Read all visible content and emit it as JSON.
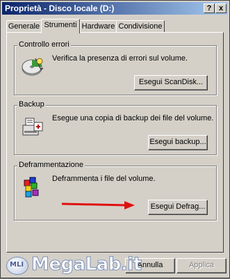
{
  "window": {
    "title": "Proprietà - Disco locale (D:)",
    "help_label": "?",
    "close_label": "x"
  },
  "tabs": [
    {
      "label": "Generale"
    },
    {
      "label": "Strumenti"
    },
    {
      "label": "Hardware"
    },
    {
      "label": "Condivisione"
    }
  ],
  "groups": {
    "error_check": {
      "title": "Controllo errori",
      "text": "Verifica la presenza di errori sul volume.",
      "button": "Esegui ScanDisk..."
    },
    "backup": {
      "title": "Backup",
      "text": "Esegue una copia di backup dei file del volume.",
      "button": "Esegui backup..."
    },
    "defrag": {
      "title": "Deframmentazione",
      "text": "Deframmenta i file del volume.",
      "button": "Esegui Defrag..."
    }
  },
  "footer": {
    "cancel_label": "Annulla",
    "apply_label": "Applica"
  },
  "watermark": {
    "text": "MegaLab.it",
    "logo_text": "MLI"
  },
  "colors": {
    "arrow": "#e01010",
    "titlebar_start": "#0a246a",
    "titlebar_end": "#a6caf0"
  }
}
